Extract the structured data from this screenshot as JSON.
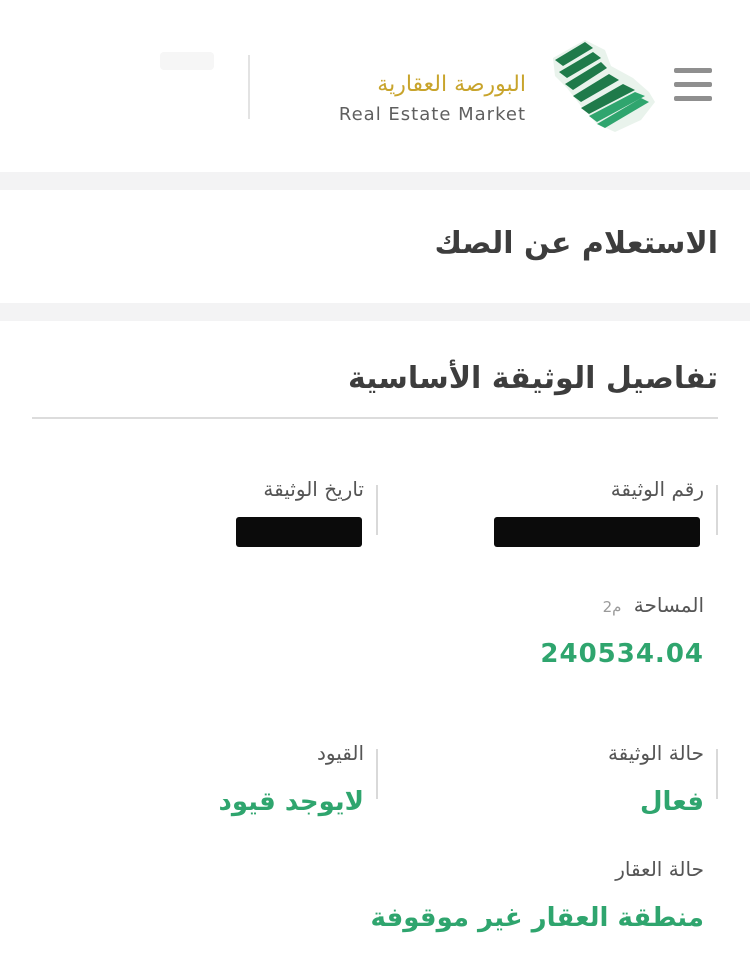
{
  "header": {
    "logo_ar": "البورصة العقارية",
    "logo_en": "Real Estate Market",
    "menu_icon": "hamburger-menu-icon",
    "colors": {
      "logo_gold": "#c8a42c",
      "logo_green": "#1f7a4a",
      "accent_green": "#2fa56e"
    }
  },
  "page": {
    "title": "الاستعلام عن الصك"
  },
  "details": {
    "section_title": "تفاصيل الوثيقة الأساسية",
    "document_number": {
      "label": "رقم الوثيقة",
      "value_redacted": true
    },
    "document_date": {
      "label": "تاريخ الوثيقة",
      "value_redacted": true
    },
    "area": {
      "label": "المساحة",
      "unit": "م2",
      "value": "240534.04"
    },
    "document_status": {
      "label": "حالة الوثيقة",
      "value": "فعال"
    },
    "restrictions": {
      "label": "القيود",
      "value": "لايوجد قيود"
    },
    "property_status": {
      "label": "حالة العقار",
      "value": "منطقة العقار غير موقوفة"
    }
  }
}
